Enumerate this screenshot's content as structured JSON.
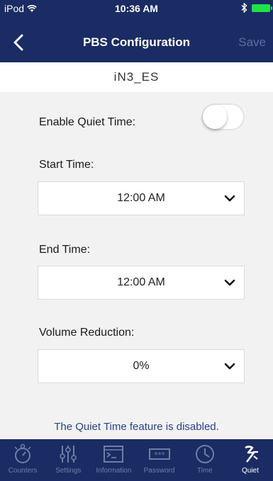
{
  "status": {
    "carrier": "iPod",
    "time": "10:36 AM"
  },
  "nav": {
    "title": "PBS Configuration",
    "save_label": "Save"
  },
  "device_name": "iN3_ES",
  "form": {
    "enable_label": "Enable Quiet Time:",
    "enable_on": false,
    "start_label": "Start Time:",
    "start_value": "12:00 AM",
    "end_label": "End Time:",
    "end_value": "12:00 AM",
    "volume_label": "Volume Reduction:",
    "volume_value": "0%"
  },
  "message": "The Quiet Time feature is disabled.",
  "tabs": [
    {
      "label": "Counters",
      "icon": "stopwatch-icon"
    },
    {
      "label": "Settings",
      "icon": "sliders-icon"
    },
    {
      "label": "Information",
      "icon": "terminal-icon"
    },
    {
      "label": "Password",
      "icon": "password-icon"
    },
    {
      "label": "Time",
      "icon": "clock-icon"
    },
    {
      "label": "Quiet",
      "icon": "quiet-icon"
    }
  ],
  "active_tab": 5,
  "colors": {
    "nav_bg": "#1a2c63",
    "message": "#2b4189",
    "tab_inactive": "#6f7ea8"
  }
}
